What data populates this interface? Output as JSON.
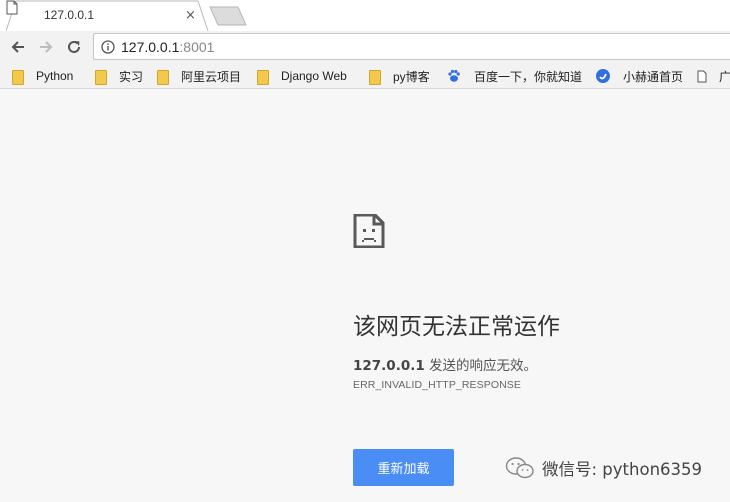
{
  "tab": {
    "title": "127.0.0.1",
    "close_glyph": "×"
  },
  "toolbar": {
    "back_icon": "back-arrow-icon",
    "forward_icon": "forward-arrow-icon",
    "reload_icon": "reload-icon",
    "url_host": "127.0.0.1",
    "url_port": ":8001"
  },
  "bookmarks": [
    {
      "label": "Python",
      "icon": "folder-icon"
    },
    {
      "label": "实习",
      "icon": "folder-icon"
    },
    {
      "label": "阿里云项目",
      "icon": "folder-icon"
    },
    {
      "label": "Django Web",
      "icon": "folder-icon"
    },
    {
      "label": "py博客",
      "icon": "folder-icon"
    },
    {
      "label": "百度一下，你就知道",
      "icon": "baidu-paw-icon"
    },
    {
      "label": "小赫通首页",
      "icon": "blue-circle-icon"
    },
    {
      "label": "广",
      "icon": "page-icon"
    }
  ],
  "error": {
    "title": "该网页无法正常运作",
    "host": "127.0.0.1",
    "message": " 发送的响应无效。",
    "code": "ERR_INVALID_HTTP_RESPONSE",
    "reload_label": "重新加载"
  },
  "watermark": {
    "text": "微信号: python6359"
  },
  "colors": {
    "accent_button": "#4a8df5",
    "page_bg": "#f7f7f7"
  }
}
